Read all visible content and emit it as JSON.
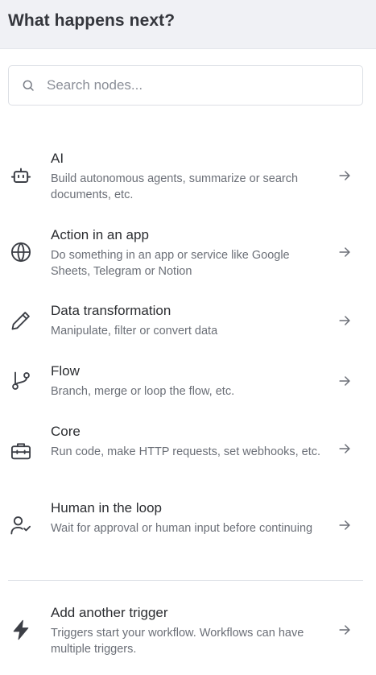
{
  "header": {
    "title": "What happens next?"
  },
  "search": {
    "placeholder": "Search nodes...",
    "value": "",
    "icon": "search-icon"
  },
  "categories": [
    {
      "title": "AI",
      "description": "Build autonomous agents, summarize or search documents, etc.",
      "icon": "robot-icon"
    },
    {
      "title": "Action in an app",
      "description": "Do something in an app or service like Google Sheets, Telegram or Notion",
      "icon": "globe-icon"
    },
    {
      "title": "Data transformation",
      "description": "Manipulate, filter or convert data",
      "icon": "pencil-icon"
    },
    {
      "title": "Flow",
      "description": "Branch, merge or loop the flow, etc.",
      "icon": "git-branch-icon"
    },
    {
      "title": "Core",
      "description": "Run code, make HTTP requests, set webhooks, etc.",
      "icon": "toolbox-icon"
    },
    {
      "title": "Human in the loop",
      "description": "Wait for approval or human input before continuing",
      "icon": "user-check-icon"
    }
  ],
  "trigger": {
    "title": "Add another trigger",
    "description": "Triggers start your workflow. Workflows can have multiple triggers.",
    "icon": "bolt-icon"
  },
  "colors": {
    "header_background": "#f0f1f5",
    "title_text": "#34363c",
    "description_text": "#6b6f77",
    "icon_stroke": "#3c3f46",
    "border": "#dcdfe5"
  }
}
